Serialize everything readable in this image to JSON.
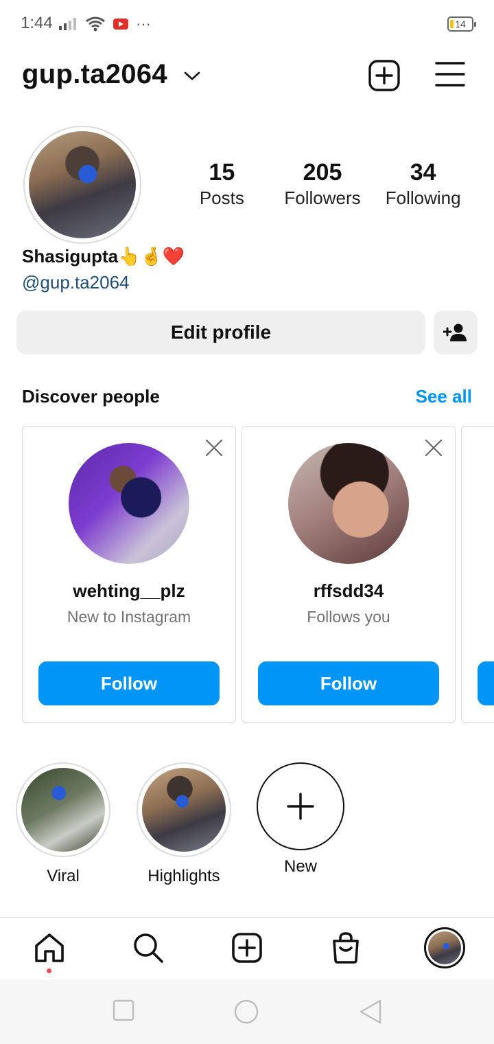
{
  "status": {
    "time": "1:44",
    "battery": "14",
    "more": "···"
  },
  "header": {
    "username": "gup.ta2064"
  },
  "profile": {
    "posts_count": "15",
    "posts_label": "Posts",
    "followers_count": "205",
    "followers_label": "Followers",
    "following_count": "34",
    "following_label": "Following",
    "full_name": "Shasigupta👆🤞❤️",
    "handle": "@gup.ta2064",
    "edit_label": "Edit profile"
  },
  "discover": {
    "title": "Discover people",
    "see_all": "See all",
    "cards": [
      {
        "username": "wehting__plz",
        "subtitle": "New to Instagram",
        "button": "Follow"
      },
      {
        "username": "rffsdd34",
        "subtitle": "Follows you",
        "button": "Follow"
      }
    ]
  },
  "highlights": [
    {
      "label": "Viral"
    },
    {
      "label": "Highlights"
    },
    {
      "label": "New"
    }
  ],
  "colors": {
    "accent": "#0095f6",
    "link": "#1e4e79",
    "notification": "#ed4956"
  },
  "icons": {
    "header": [
      "chevron-down-icon",
      "new-post-icon",
      "menu-icon"
    ],
    "tabbar": [
      "home-icon",
      "search-icon",
      "create-icon",
      "shop-icon",
      "profile-avatar"
    ],
    "system": [
      "recents-icon",
      "home-circle-icon",
      "back-icon"
    ]
  }
}
